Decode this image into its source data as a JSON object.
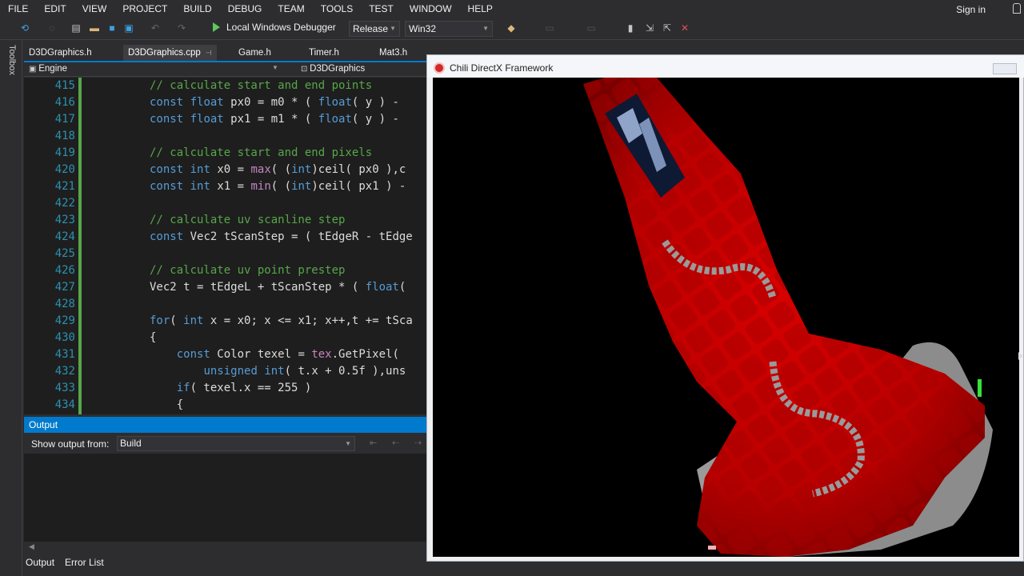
{
  "menu": {
    "items": [
      "FILE",
      "EDIT",
      "VIEW",
      "PROJECT",
      "BUILD",
      "DEBUG",
      "TEAM",
      "TOOLS",
      "TEST",
      "WINDOW",
      "HELP"
    ],
    "sign_in": "Sign in"
  },
  "toolbar": {
    "debugger": "Local Windows Debugger",
    "configuration": "Release",
    "platform": "Win32"
  },
  "toolbox": {
    "label": "Toolbox"
  },
  "tabs": [
    {
      "label": "D3DGraphics.h",
      "active": false
    },
    {
      "label": "D3DGraphics.cpp",
      "active": true
    },
    {
      "label": "Game.h",
      "active": false
    },
    {
      "label": "Timer.h",
      "active": false
    },
    {
      "label": "Mat3.h",
      "active": false
    }
  ],
  "navbar": {
    "scope": "Engine",
    "member": "D3DGraphics"
  },
  "code": {
    "lines": [
      {
        "n": "415",
        "text": "// calculate start and end points"
      },
      {
        "n": "416",
        "text": "const float px0 = m0 * ( float( y ) - "
      },
      {
        "n": "417",
        "text": "const float px1 = m1 * ( float( y ) - "
      },
      {
        "n": "418",
        "text": ""
      },
      {
        "n": "419",
        "text": "// calculate start and end pixels"
      },
      {
        "n": "420",
        "text": "const int x0 = max( (int)ceil( px0 ),c"
      },
      {
        "n": "421",
        "text": "const int x1 = min( (int)ceil( px1 ) - "
      },
      {
        "n": "422",
        "text": ""
      },
      {
        "n": "423",
        "text": "// calculate uv scanline step"
      },
      {
        "n": "424",
        "text": "const Vec2 tScanStep = ( tEdgeR - tEdge"
      },
      {
        "n": "425",
        "text": ""
      },
      {
        "n": "426",
        "text": "// calculate uv point prestep"
      },
      {
        "n": "427",
        "text": "Vec2 t = tEdgeL + tScanStep * ( float("
      },
      {
        "n": "428",
        "text": ""
      },
      {
        "n": "429",
        "text": "for( int x = x0; x <= x1; x++,t += tSca"
      },
      {
        "n": "430",
        "text": "{"
      },
      {
        "n": "431",
        "text": "    const Color texel = tex.GetPixel("
      },
      {
        "n": "432",
        "text": "        unsigned int( t.x + 0.5f ),uns"
      },
      {
        "n": "433",
        "text": "    if( texel.x == 255 )"
      },
      {
        "n": "434",
        "text": "    {"
      }
    ]
  },
  "output": {
    "title": "Output",
    "show_from_label": "Show output from:",
    "source": "Build",
    "bottom_tabs": [
      "Output",
      "Error List"
    ]
  },
  "dx_window": {
    "title": "Chili DirectX Framework"
  },
  "colors": {
    "accent": "#007acc",
    "ship_red": "#c80000",
    "keyword": "#569cd6",
    "comment": "#57a64a",
    "line_number": "#2b91af"
  }
}
